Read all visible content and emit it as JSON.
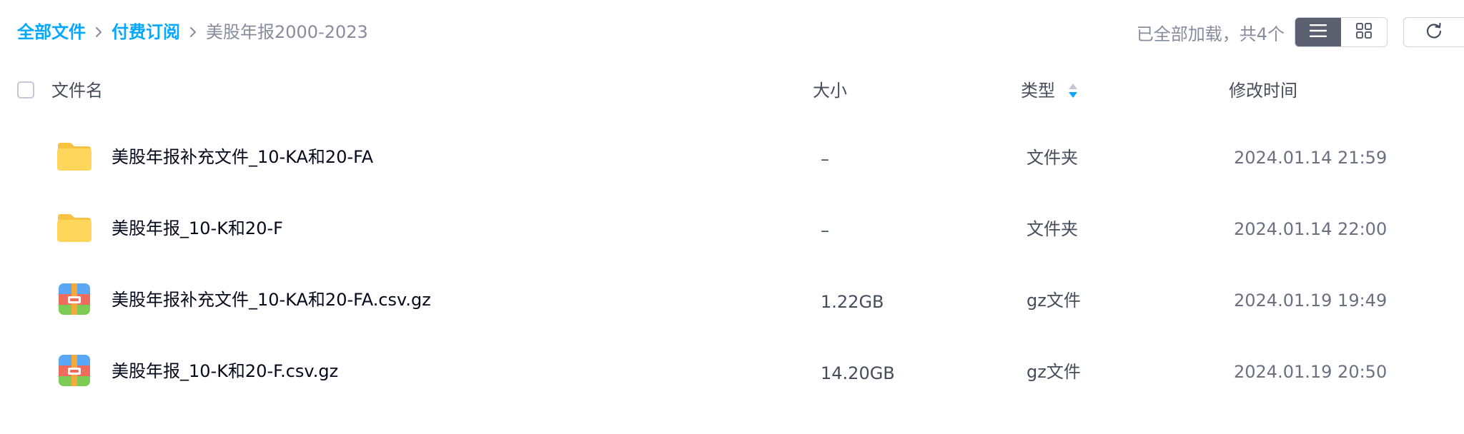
{
  "breadcrumb": {
    "root": "全部文件",
    "parent": "付费订阅",
    "current": "美股年报2000-2023"
  },
  "status": "已全部加载，共4个",
  "toolbar": {
    "list_view_icon": "list-icon",
    "grid_view_icon": "grid-icon",
    "refresh_icon": "refresh-icon",
    "active_view": "list"
  },
  "columns": {
    "name": "文件名",
    "size": "大小",
    "type": "类型",
    "time": "修改时间"
  },
  "colors": {
    "link": "#06a7ff",
    "muted": "#878c9c",
    "active_toggle": "#5b6070"
  },
  "files": [
    {
      "name": "美股年报补充文件_10-KA和20-FA",
      "size": "–",
      "type": "文件夹",
      "time": "2024.01.14 21:59",
      "icon": "folder-icon"
    },
    {
      "name": "美股年报_10-K和20-F",
      "size": "–",
      "type": "文件夹",
      "time": "2024.01.14 22:00",
      "icon": "folder-icon"
    },
    {
      "name": "美股年报补充文件_10-KA和20-FA.csv.gz",
      "size": "1.22GB",
      "type": "gz文件",
      "time": "2024.01.19 19:49",
      "icon": "archive-icon"
    },
    {
      "name": "美股年报_10-K和20-F.csv.gz",
      "size": "14.20GB",
      "type": "gz文件",
      "time": "2024.01.19 20:50",
      "icon": "archive-icon"
    }
  ]
}
